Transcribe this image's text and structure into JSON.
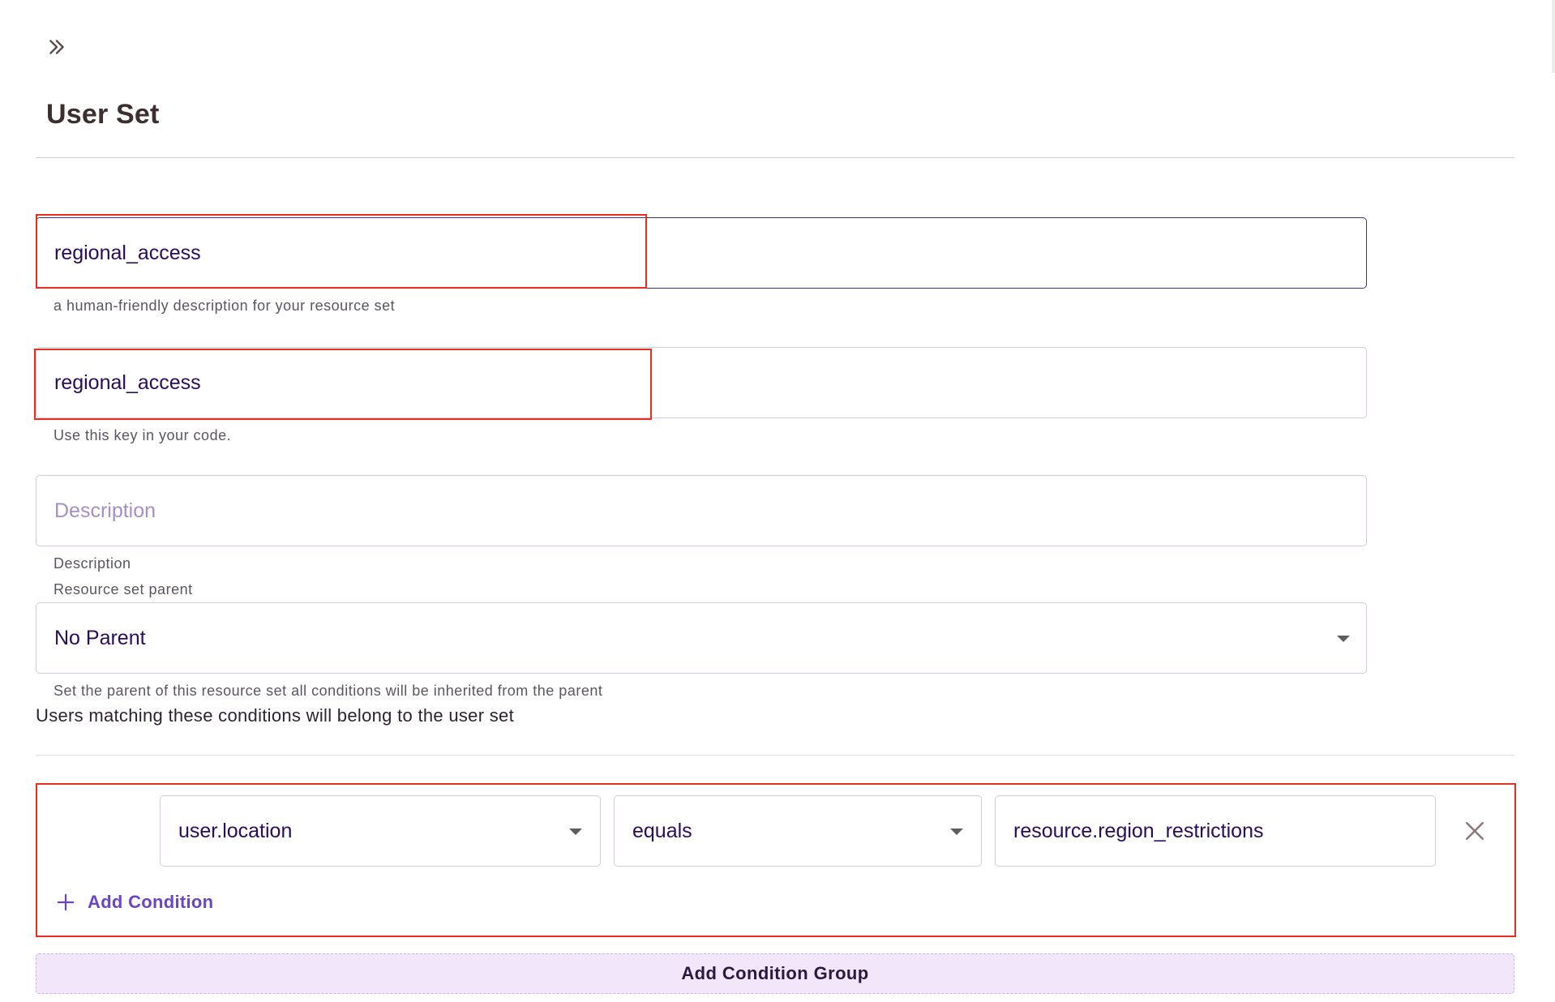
{
  "header": {
    "expand_icon": "double-chevron-right-icon",
    "title": "User Set"
  },
  "form": {
    "name": {
      "value": "regional_access",
      "helper": "a human-friendly description for your resource set"
    },
    "key": {
      "value": "regional_access",
      "helper": "Use this key in your code."
    },
    "description": {
      "placeholder": "Description",
      "helper": "Description"
    },
    "parent": {
      "label": "Resource set parent",
      "value": "No Parent",
      "helper": "Set the parent of this resource set all conditions will be inherited from the parent"
    }
  },
  "conditions": {
    "intro": "Users matching these conditions will belong to the user set",
    "rows": [
      {
        "attribute": "user.location",
        "operator": "equals",
        "value": "resource.region_restrictions"
      }
    ],
    "add_condition_label": "Add Condition",
    "add_group_label": "Add Condition Group"
  },
  "colors": {
    "accent": "#6a45c5",
    "annotation": "#e53020",
    "group_button_bg": "#f1e6fa"
  }
}
